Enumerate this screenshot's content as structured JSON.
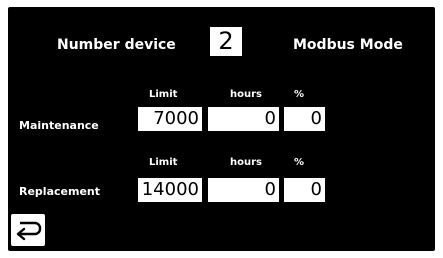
{
  "header": {
    "number_device_label": "Number device",
    "number_device_value": "2",
    "mode_label": "Modbus Mode"
  },
  "maintenance": {
    "label": "Maintenance",
    "limit_label": "Limit",
    "hours_label": "hours",
    "percent_label": "%",
    "limit_value": "7000",
    "hours_value": "0",
    "percent_value": "0"
  },
  "replacement": {
    "label": "Replacement",
    "limit_label": "Limit",
    "hours_label": "hours",
    "percent_label": "%",
    "limit_value": "14000",
    "hours_value": "0",
    "percent_value": "0"
  },
  "footer": {
    "back_icon": "return-arrow-icon"
  },
  "colors": {
    "background": "#000000",
    "text": "#ffffff",
    "field_background": "#ffffff",
    "field_text": "#000000"
  }
}
